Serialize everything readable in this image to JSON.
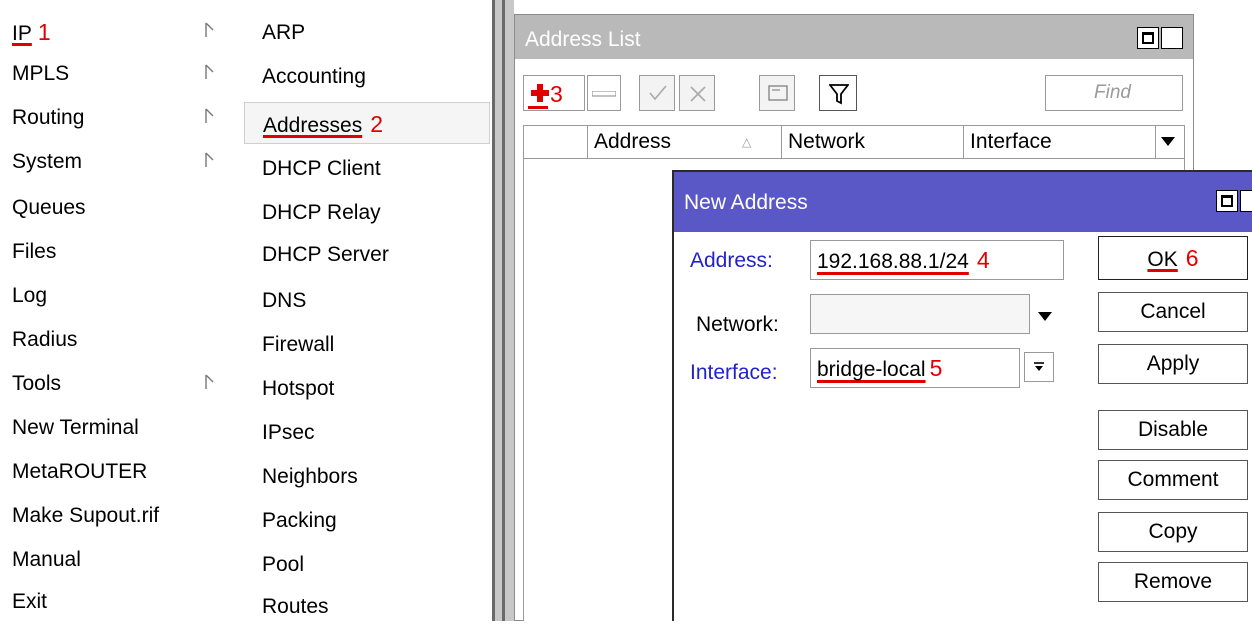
{
  "main_menu": {
    "items": [
      {
        "label": "IP",
        "annotation": "1",
        "has_submenu": true
      },
      {
        "label": "MPLS",
        "has_submenu": true
      },
      {
        "label": "Routing",
        "has_submenu": true
      },
      {
        "label": "System",
        "has_submenu": true
      },
      {
        "label": "Queues",
        "has_submenu": false
      },
      {
        "label": "Files",
        "has_submenu": false
      },
      {
        "label": "Log",
        "has_submenu": false
      },
      {
        "label": "Radius",
        "has_submenu": false
      },
      {
        "label": "Tools",
        "has_submenu": true
      },
      {
        "label": "New Terminal",
        "has_submenu": false
      },
      {
        "label": "MetaROUTER",
        "has_submenu": false
      },
      {
        "label": "Make Supout.rif",
        "has_submenu": false
      },
      {
        "label": "Manual",
        "has_submenu": false
      },
      {
        "label": "Exit",
        "has_submenu": false
      }
    ]
  },
  "ip_submenu": {
    "items": [
      {
        "label": "ARP"
      },
      {
        "label": "Accounting"
      },
      {
        "label": "Addresses",
        "annotation": "2",
        "selected": true
      },
      {
        "label": "DHCP Client"
      },
      {
        "label": "DHCP Relay"
      },
      {
        "label": "DHCP Server"
      },
      {
        "label": "DNS"
      },
      {
        "label": "Firewall"
      },
      {
        "label": "Hotspot"
      },
      {
        "label": "IPsec"
      },
      {
        "label": "Neighbors"
      },
      {
        "label": "Packing"
      },
      {
        "label": "Pool"
      },
      {
        "label": "Routes"
      }
    ]
  },
  "address_list": {
    "title": "Address List",
    "add_annotation": "3",
    "find_placeholder": "Find",
    "columns": [
      "Address",
      "Network",
      "Interface"
    ]
  },
  "new_address": {
    "title": "New Address",
    "address_label": "Address:",
    "address_value": "192.168.88.1/24",
    "address_annotation": "4",
    "network_label": "Network:",
    "network_value": "",
    "interface_label": "Interface:",
    "interface_value": "bridge-local",
    "interface_annotation": "5",
    "buttons": {
      "ok": "OK",
      "ok_annotation": "6",
      "cancel": "Cancel",
      "apply": "Apply",
      "disable": "Disable",
      "comment": "Comment",
      "copy": "Copy",
      "remove": "Remove"
    }
  },
  "colors": {
    "annotation_red": "#e00000",
    "dialog_titlebar": "#5a58c6",
    "inactive_titlebar": "#b9b9b9",
    "field_label_blue": "#2222cc"
  }
}
